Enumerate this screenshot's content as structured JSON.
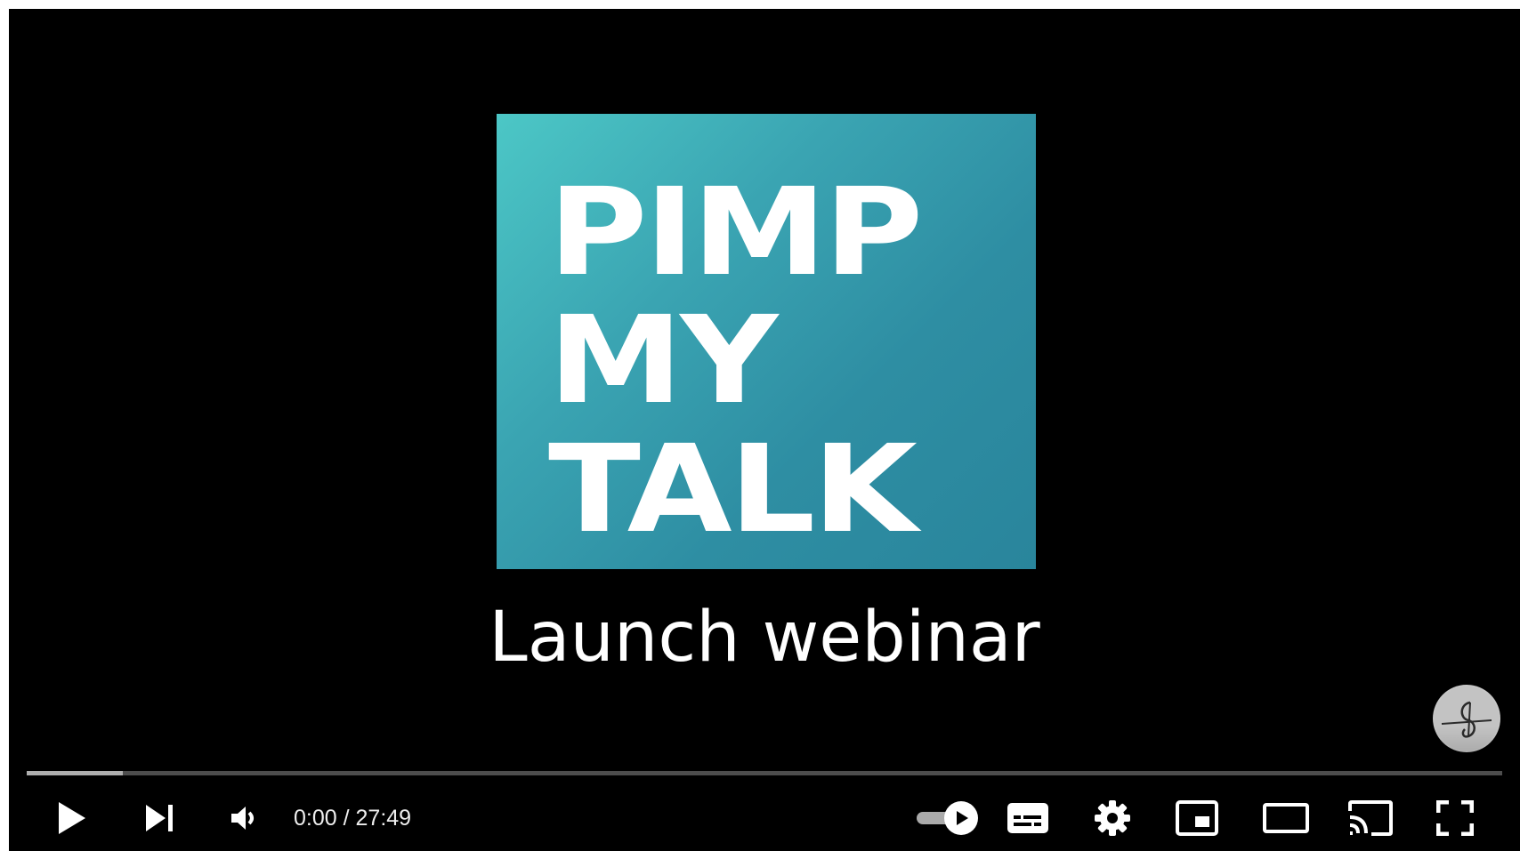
{
  "video": {
    "logo_lines": [
      "PIMP",
      "MY",
      "TALK"
    ],
    "subtitle": "Launch webinar",
    "logo_color": "#3399aa",
    "channel_watermark_icon": "channel-watermark-icon"
  },
  "player": {
    "progress": 0,
    "loaded_fraction": 0.065,
    "current_time": "0:00",
    "separator": " / ",
    "duration": "27:49",
    "autoplay_on": true,
    "controls": {
      "play": "play-icon",
      "next": "next-icon",
      "volume": "volume-icon",
      "autoplay": "autoplay-toggle-icon",
      "captions": "captions-icon",
      "settings": "gear-icon",
      "miniplayer": "miniplayer-icon",
      "theater": "theater-mode-icon",
      "cast": "cast-icon",
      "fullscreen": "fullscreen-icon"
    }
  },
  "colors": {
    "progress_played": "#ff0000",
    "background": "#000000",
    "controls": "#ffffff"
  }
}
